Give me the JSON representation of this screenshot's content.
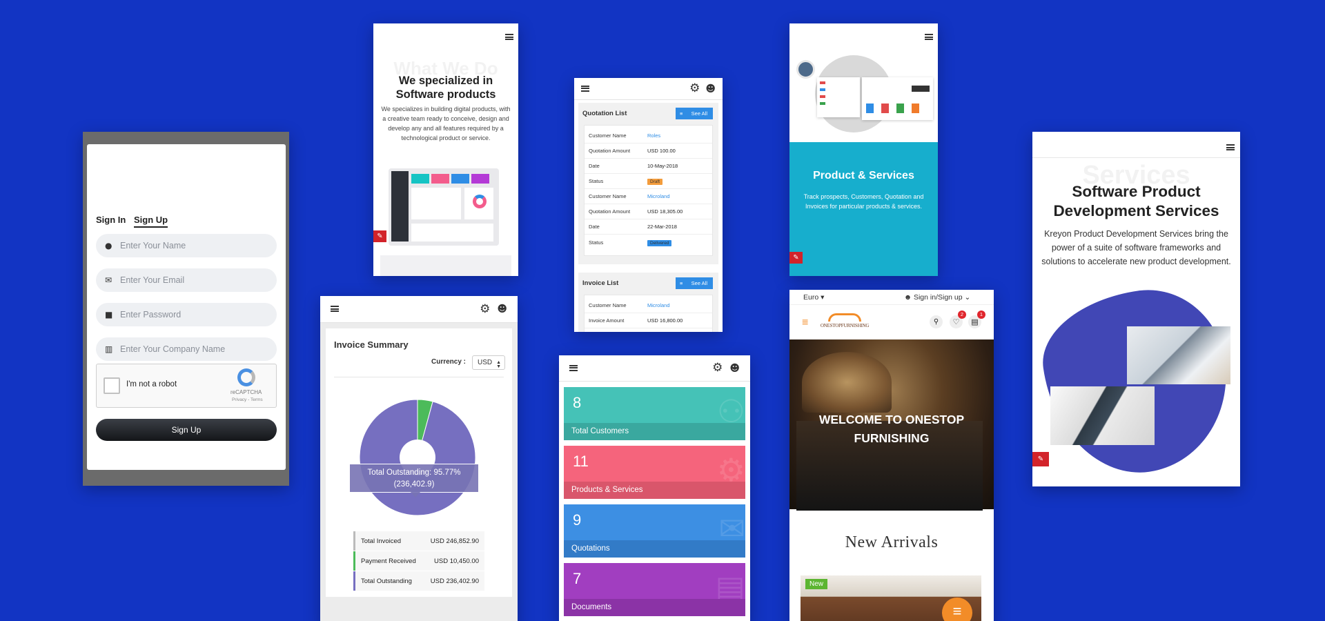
{
  "signup": {
    "tabs": [
      "Sign In",
      "Sign Up"
    ],
    "fields": [
      {
        "icon": "user-icon",
        "glyph": "●",
        "placeholder": "Enter Your Name"
      },
      {
        "icon": "mail-icon",
        "glyph": "✉",
        "placeholder": "Enter Your Email"
      },
      {
        "icon": "lock-icon",
        "glyph": "■",
        "placeholder": "Enter Password"
      },
      {
        "icon": "building-icon",
        "glyph": "▥",
        "placeholder": "Enter Your Company Name"
      }
    ],
    "captcha_label": "I'm not a robot",
    "captcha_brand": "reCAPTCHA",
    "captcha_terms": "Privacy - Terms",
    "button": "Sign Up"
  },
  "whatwedo": {
    "ghost": "What We Do",
    "title_line1": "We specialized in",
    "title_line2": "Software products",
    "body": "We specializes in building digital products, with a creative team ready to conceive, design and develop any and all features required by a technological product or service."
  },
  "quotation": {
    "title": "Quotation List",
    "see_all": "See All",
    "records": [
      {
        "customer_label": "Customer Name",
        "customer": "Roles",
        "amount_label": "Quotation Amount",
        "amount": "USD 100.00",
        "date_label": "Date",
        "date": "10-May-2018",
        "status_label": "Status",
        "status": "Draft"
      },
      {
        "customer_label": "Customer Name",
        "customer": "Microland",
        "amount_label": "Quotation Amount",
        "amount": "USD 18,305.00",
        "date_label": "Date",
        "date": "22-Mar-2018",
        "status_label": "Status",
        "status": "Delivered"
      }
    ],
    "invoice_title": "Invoice List",
    "invoice_see_all": "See All",
    "invoice_record": {
      "customer_label": "Customer Name",
      "customer": "Microland",
      "amount_label": "Invoice Amount",
      "amount": "USD 16,800.00"
    }
  },
  "products": {
    "title": "Product & Services",
    "body": "Track prospects, Customers, Quotation and Invoices for particular products & services."
  },
  "services": {
    "ghost": "Services",
    "title_line1": "Software Product",
    "title_line2": "Development Services",
    "body": "Kreyon Product Development Services bring the power of a suite of software frameworks and solutions to accelerate new product development."
  },
  "invoice": {
    "title": "Invoice Summary",
    "currency_label": "Currency :",
    "currency_value": "USD",
    "tooltip_line1": "Total Outstanding: 95.77%",
    "tooltip_line2": "(236,402.9)",
    "legend": [
      {
        "label": "Total Invoiced",
        "value": "USD 246,852.90",
        "color": "#bbbbbb"
      },
      {
        "label": "Payment Received",
        "value": "USD 10,450.00",
        "color": "#4cbb5a"
      },
      {
        "label": "Total Outstanding",
        "value": "USD 236,402.90",
        "color": "#766fc0"
      }
    ]
  },
  "chart_data": {
    "type": "pie",
    "categories": [
      "Total Outstanding",
      "Payment Received"
    ],
    "values": [
      236402.9,
      10450.0
    ],
    "percent": [
      95.77,
      4.23
    ],
    "colors": [
      "#766fc0",
      "#4cbb5a"
    ],
    "title": ""
  },
  "dashboard": {
    "tiles": [
      {
        "count": "8",
        "label": "Total Customers",
        "color": "#45c2b7",
        "band": "#3aa89f",
        "icon": "users-icon",
        "glyph": "⚇"
      },
      {
        "count": "11",
        "label": "Products & Services",
        "color": "#f5647c",
        "band": "#d9566b",
        "icon": "gear-icon",
        "glyph": "⚙"
      },
      {
        "count": "9",
        "label": "Quotations",
        "color": "#3d8fe3",
        "band": "#327bc7",
        "icon": "envelope-icon",
        "glyph": "✉"
      },
      {
        "count": "7",
        "label": "Documents",
        "color": "#a13ec0",
        "band": "#8b33a6",
        "icon": "document-icon",
        "glyph": "▤"
      }
    ]
  },
  "store": {
    "currency": "Euro",
    "signin": "Sign in/Sign up",
    "logo": "ONESTOPFURNISHING",
    "wishlist_count": "2",
    "cart_count": "1",
    "hero_line1": "WELCOME TO ONESTOP",
    "hero_line2": "FURNISHING",
    "section_title": "New Arrivals",
    "new_badge": "New"
  }
}
